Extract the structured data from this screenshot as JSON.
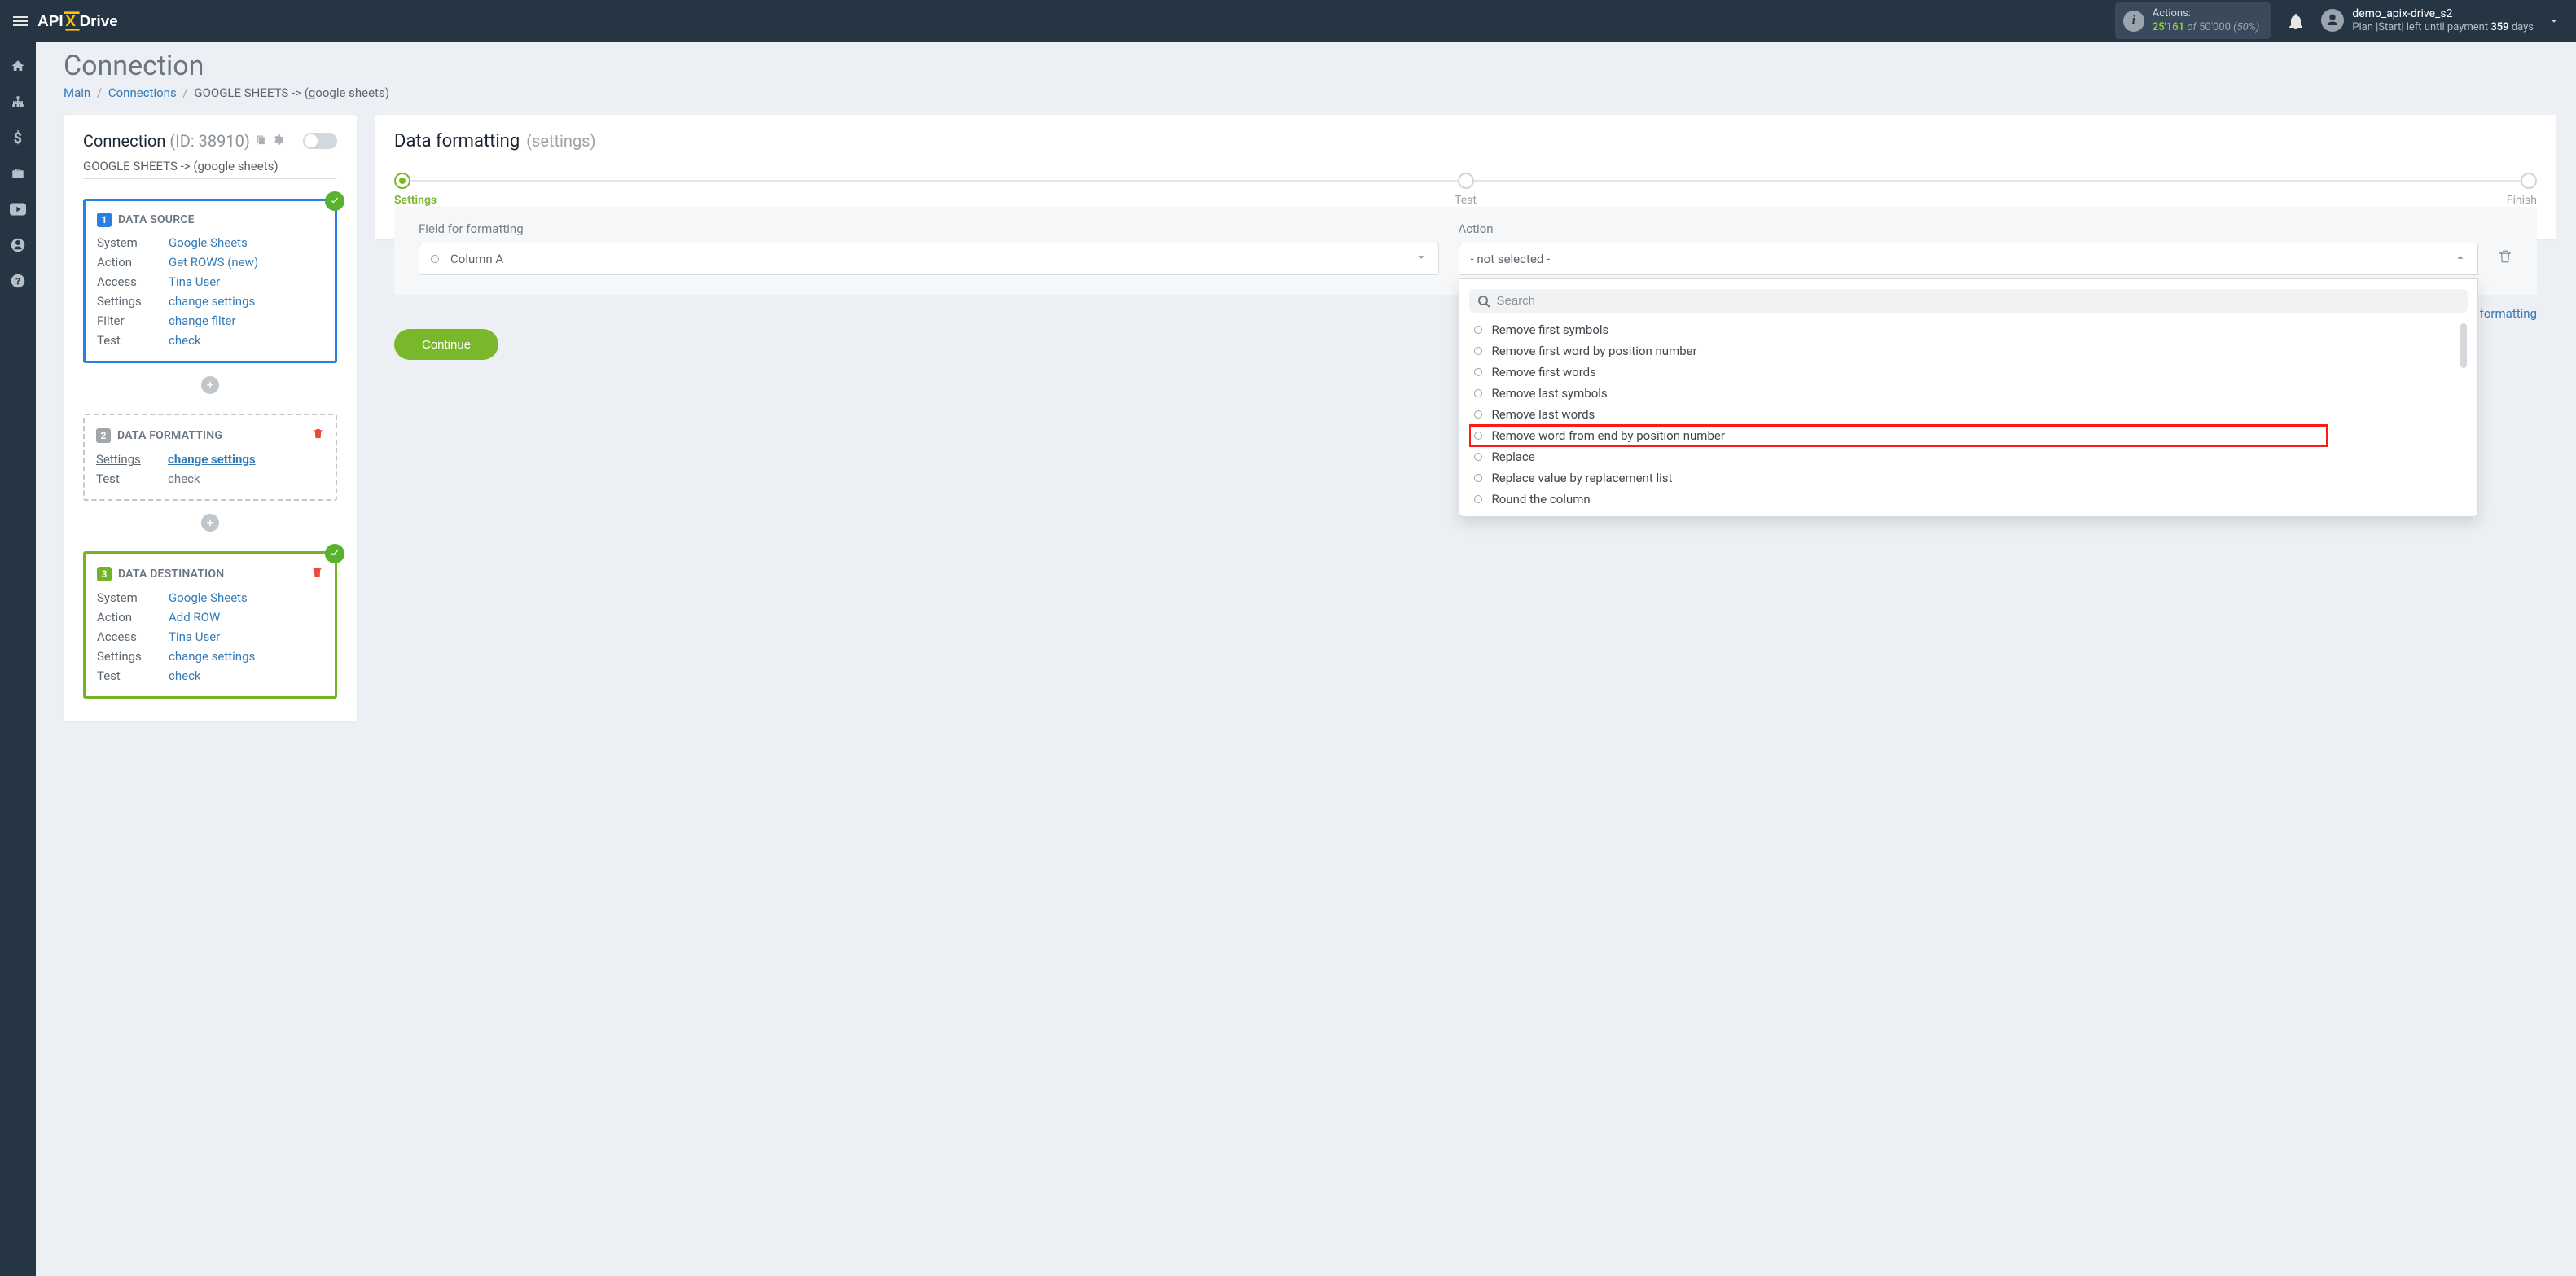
{
  "header": {
    "actions_label": "Actions:",
    "actions_used": "25'161",
    "actions_of": "of",
    "actions_total": "50'000",
    "actions_pct": "(50%)",
    "username": "demo_apix-drive_s2",
    "plan_prefix": "Plan |Start| left until payment",
    "plan_days": "359",
    "plan_days_suffix": "days"
  },
  "page": {
    "title": "Connection",
    "breadcrumbs": {
      "main": "Main",
      "connections": "Connections",
      "current": "GOOGLE SHEETS -> (google sheets)"
    }
  },
  "connection": {
    "hdr_title": "Connection",
    "hdr_id": "(ID: 38910)",
    "subtitle": "GOOGLE SHEETS -> (google sheets)",
    "source": {
      "title": "DATA SOURCE",
      "system_k": "System",
      "system_v": "Google Sheets",
      "action_k": "Action",
      "action_v": "Get ROWS (new)",
      "access_k": "Access",
      "access_v": "Tina User",
      "settings_k": "Settings",
      "settings_v": "change settings",
      "filter_k": "Filter",
      "filter_v": "change filter",
      "test_k": "Test",
      "test_v": "check"
    },
    "formatting": {
      "title": "DATA FORMATTING",
      "settings_k": "Settings",
      "settings_v": "change settings",
      "test_k": "Test",
      "test_v": "check"
    },
    "destination": {
      "title": "DATA DESTINATION",
      "system_k": "System",
      "system_v": "Google Sheets",
      "action_k": "Action",
      "action_v": "Add ROW",
      "access_k": "Access",
      "access_v": "Tina User",
      "settings_k": "Settings",
      "settings_v": "change settings",
      "test_k": "Test",
      "test_v": "check"
    }
  },
  "right": {
    "title": "Data formatting",
    "subtitle": "(settings)",
    "steps": [
      "Settings",
      "Test",
      "Finish"
    ],
    "field_label": "Field for formatting",
    "field_value": "Column A",
    "action_label": "Action",
    "action_value": "- not selected -",
    "search_placeholder": "Search",
    "dropdown": [
      "Remove first symbols",
      "Remove first word by position number",
      "Remove first words",
      "Remove last symbols",
      "Remove last words",
      "Remove word from end by position number",
      "Replace",
      "Replace value by replacement list",
      "Round the column"
    ],
    "add_link": "+ Add more field for formatting",
    "continue": "Continue"
  }
}
